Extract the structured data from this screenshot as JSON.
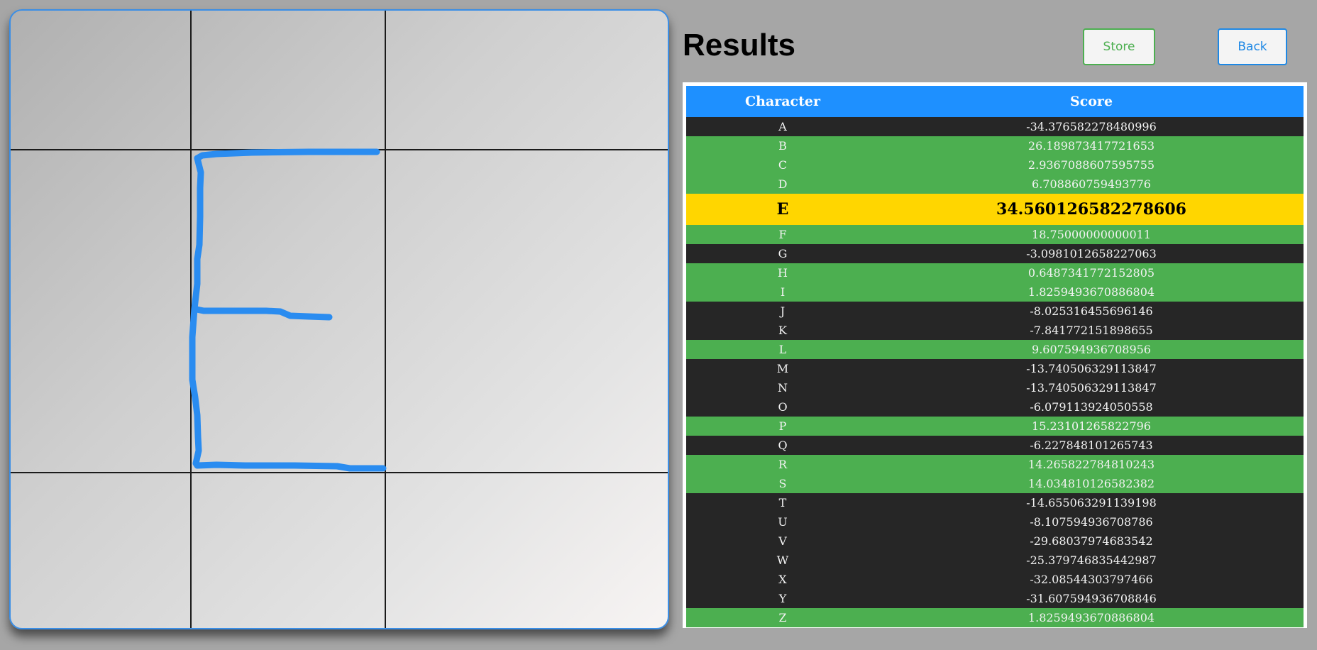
{
  "page": {
    "title": "Results"
  },
  "buttons": {
    "store_label": "Store",
    "back_label": "Back"
  },
  "colors": {
    "accent_blue": "#1e90ff",
    "positive_row": "#4caf50",
    "negative_row": "#262626",
    "best_row": "#ffd600",
    "stroke": "#2a8cf0"
  },
  "table": {
    "headers": {
      "character": "Character",
      "score": "Score"
    },
    "best_character": "E",
    "rows": [
      {
        "char": "A",
        "score": "-34.376582278480996"
      },
      {
        "char": "B",
        "score": "26.189873417721653"
      },
      {
        "char": "C",
        "score": "2.9367088607595755"
      },
      {
        "char": "D",
        "score": "6.708860759493776"
      },
      {
        "char": "E",
        "score": "34.560126582278606"
      },
      {
        "char": "F",
        "score": "18.75000000000011"
      },
      {
        "char": "G",
        "score": "-3.0981012658227063"
      },
      {
        "char": "H",
        "score": "0.6487341772152805"
      },
      {
        "char": "I",
        "score": "1.8259493670886804"
      },
      {
        "char": "J",
        "score": "-8.025316455696146"
      },
      {
        "char": "K",
        "score": "-7.841772151898655"
      },
      {
        "char": "L",
        "score": "9.607594936708956"
      },
      {
        "char": "M",
        "score": "-13.740506329113847"
      },
      {
        "char": "N",
        "score": "-13.740506329113847"
      },
      {
        "char": "O",
        "score": "-6.079113924050558"
      },
      {
        "char": "P",
        "score": "15.23101265822796"
      },
      {
        "char": "Q",
        "score": "-6.227848101265743"
      },
      {
        "char": "R",
        "score": "14.265822784810243"
      },
      {
        "char": "S",
        "score": "14.034810126582382"
      },
      {
        "char": "T",
        "score": "-14.655063291139198"
      },
      {
        "char": "U",
        "score": "-8.107594936708786"
      },
      {
        "char": "V",
        "score": "-29.68037974683542"
      },
      {
        "char": "W",
        "score": "-25.379746835442987"
      },
      {
        "char": "X",
        "score": "-32.08544303797466"
      },
      {
        "char": "Y",
        "score": "-31.607594936708846"
      },
      {
        "char": "Z",
        "score": "1.8259493670886804"
      }
    ]
  }
}
